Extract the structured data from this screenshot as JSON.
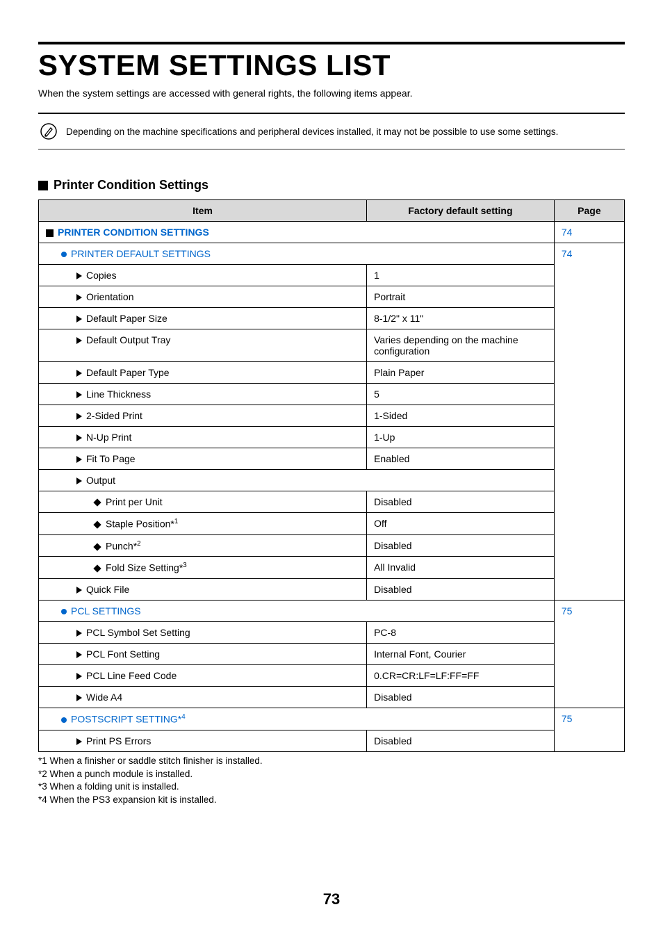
{
  "title": "SYSTEM SETTINGS LIST",
  "intro": "When the system settings are accessed with general rights, the following items appear.",
  "note": "Depending on the machine specifications and peripheral devices installed, it may not be possible to use some settings.",
  "section_heading": "Printer Condition Settings",
  "headers": {
    "item": "Item",
    "default": "Factory default setting",
    "page": "Page"
  },
  "groups": [
    {
      "level": 1,
      "label": "PRINTER CONDITION SETTINGS",
      "link": true,
      "page": "74",
      "rows": []
    },
    {
      "level": 2,
      "label": "PRINTER DEFAULT SETTINGS",
      "link": true,
      "page": "74",
      "rows": [
        {
          "level": 3,
          "label": "Copies",
          "default": "1"
        },
        {
          "level": 3,
          "label": "Orientation",
          "default": "Portrait"
        },
        {
          "level": 3,
          "label": "Default Paper Size",
          "default": "8-1/2\" x 11\""
        },
        {
          "level": 3,
          "label": "Default Output Tray",
          "default": "Varies depending on the machine configuration"
        },
        {
          "level": 3,
          "label": "Default Paper Type",
          "default": "Plain Paper"
        },
        {
          "level": 3,
          "label": "Line Thickness",
          "default": "5"
        },
        {
          "level": 3,
          "label": "2-Sided Print",
          "default": "1-Sided"
        },
        {
          "level": 3,
          "label": "N-Up Print",
          "default": "1-Up"
        },
        {
          "level": 3,
          "label": "Fit To Page",
          "default": "Enabled"
        },
        {
          "level": 3,
          "label": "Output",
          "default": "",
          "span": true
        },
        {
          "level": 4,
          "label": "Print per Unit",
          "default": "Disabled"
        },
        {
          "level": 4,
          "label": "Staple Position*",
          "sup": "1",
          "default": "Off"
        },
        {
          "level": 4,
          "label": "Punch*",
          "sup": "2",
          "default": "Disabled"
        },
        {
          "level": 4,
          "label": "Fold Size Setting*",
          "sup": "3",
          "default": "All Invalid"
        },
        {
          "level": 3,
          "label": "Quick File",
          "default": "Disabled"
        }
      ]
    },
    {
      "level": 2,
      "label": "PCL SETTINGS",
      "link": true,
      "page": "75",
      "rows": [
        {
          "level": 3,
          "label": "PCL Symbol Set Setting",
          "default": "PC-8"
        },
        {
          "level": 3,
          "label": "PCL Font Setting",
          "default": "Internal Font, Courier"
        },
        {
          "level": 3,
          "label": "PCL Line Feed Code",
          "default": "0.CR=CR:LF=LF:FF=FF"
        },
        {
          "level": 3,
          "label": "Wide A4",
          "default": "Disabled"
        }
      ]
    },
    {
      "level": 2,
      "label": "POSTSCRIPT SETTING*",
      "sup": "4",
      "link": true,
      "page": "75",
      "rows": [
        {
          "level": 3,
          "label": "Print PS Errors",
          "default": "Disabled"
        }
      ]
    }
  ],
  "footnotes": [
    "*1 When a finisher or saddle stitch finisher is installed.",
    "*2 When a punch module is installed.",
    "*3 When a folding unit is installed.",
    "*4 When the PS3 expansion kit is installed."
  ],
  "page_number": "73"
}
